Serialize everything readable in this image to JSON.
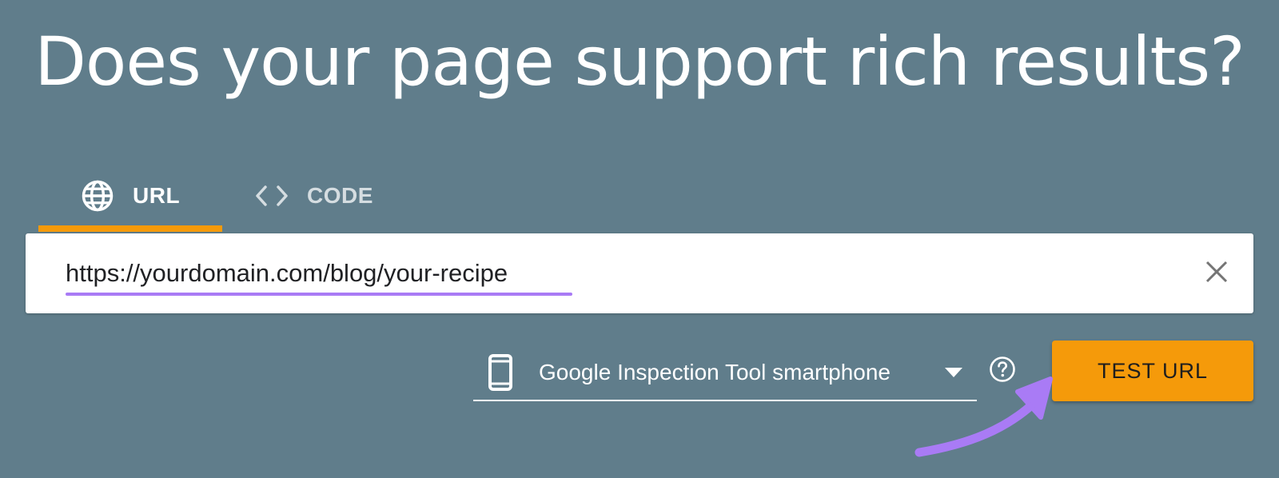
{
  "page": {
    "title": "Does your page support rich results?"
  },
  "tabs": [
    {
      "label": "URL",
      "icon": "globe-icon",
      "active": true
    },
    {
      "label": "CODE",
      "icon": "code-icon",
      "active": false
    }
  ],
  "url_input": {
    "value": "https://yourdomain.com/blog/your-recipe",
    "clear_icon": "close-icon"
  },
  "device_select": {
    "selected": "Google Inspection Tool smartphone",
    "icon": "smartphone-icon",
    "arrow_icon": "dropdown-arrow-icon"
  },
  "help": {
    "icon": "help-circle-icon"
  },
  "test_button": {
    "label": "TEST URL"
  },
  "colors": {
    "background": "#607d8b",
    "accent": "#f59a0a",
    "highlight": "#a97bf5",
    "text_light": "#ffffff"
  }
}
